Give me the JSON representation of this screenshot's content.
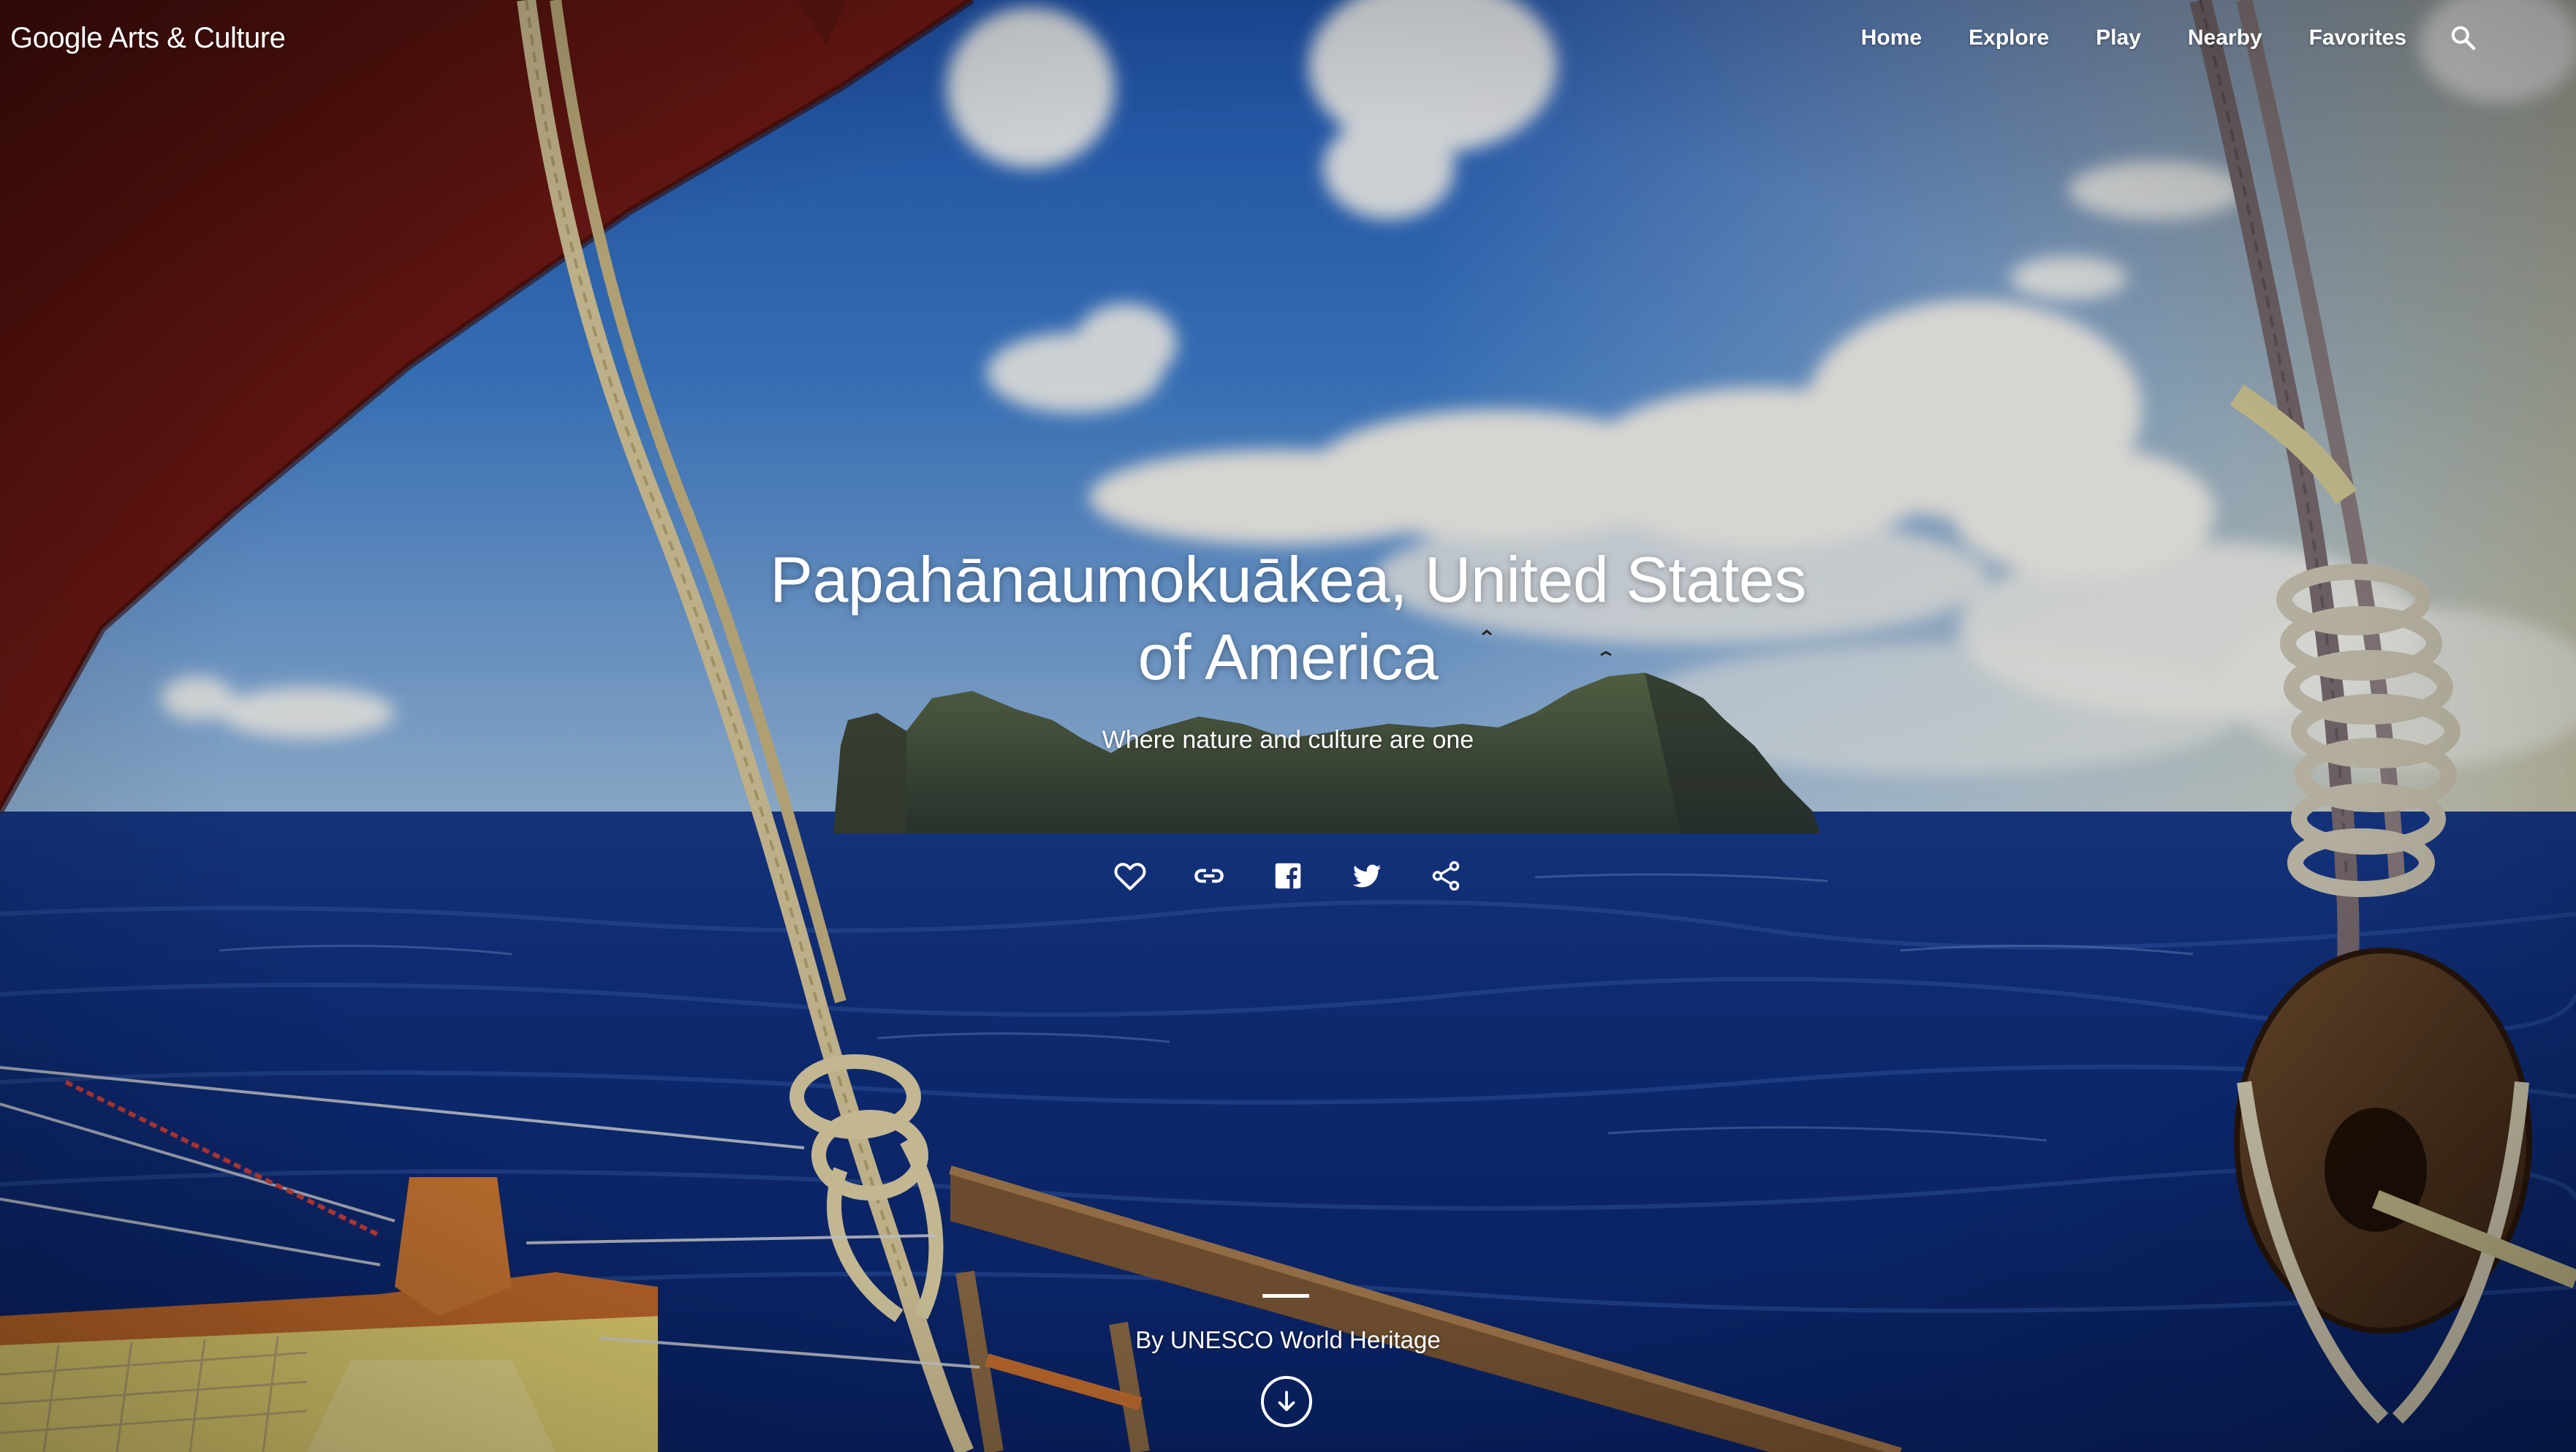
{
  "brand": {
    "google": "Google",
    "product": "Arts & Culture"
  },
  "nav": {
    "items": [
      "Home",
      "Explore",
      "Play",
      "Nearby",
      "Favorites"
    ],
    "search_icon": "search-icon"
  },
  "hero": {
    "title_line1": "Papahānaumokuākea, United States",
    "title_line2": "of America",
    "subtitle": "Where nature and culture are one",
    "actions": [
      "favorite-icon",
      "link-icon",
      "facebook-icon",
      "twitter-icon",
      "share-icon"
    ],
    "attribution": "By UNESCO World Heritage",
    "scroll_icon": "arrow-down-icon"
  },
  "colors": {
    "text": "#ffffff",
    "sail": "#8a1f1a",
    "sea": "#0d2f8a",
    "sky": "#3b78c8"
  }
}
